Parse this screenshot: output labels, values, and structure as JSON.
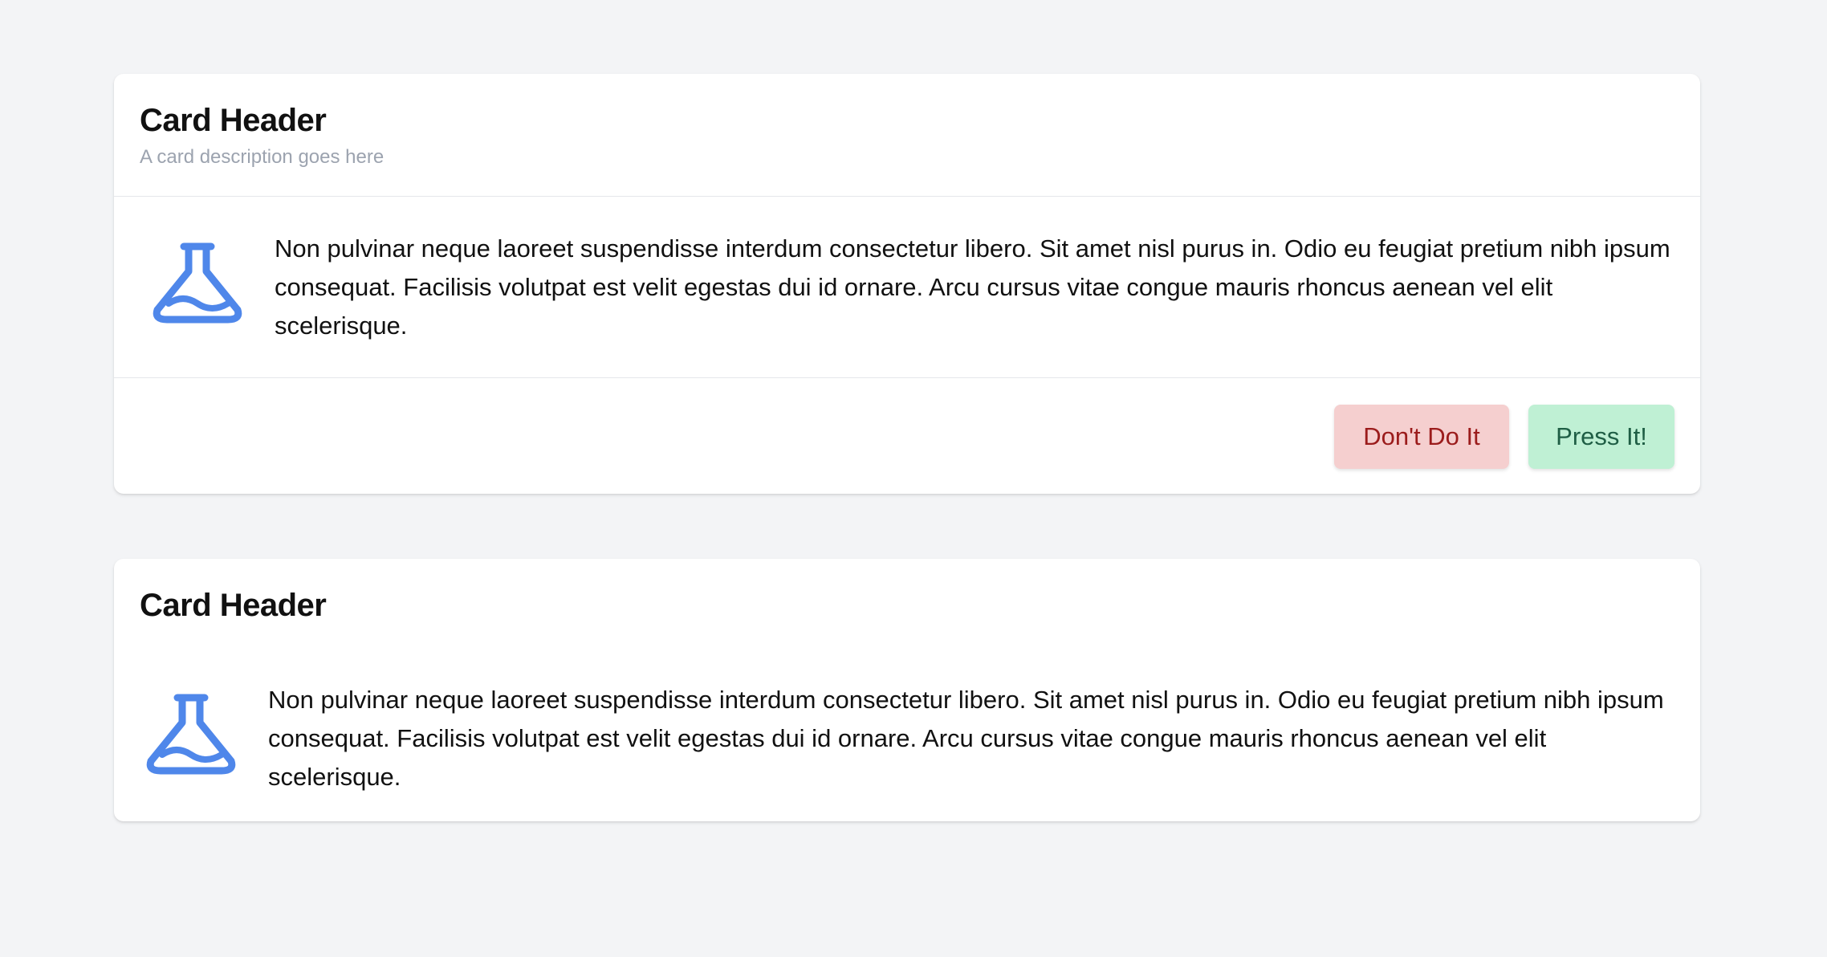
{
  "cards": [
    {
      "title": "Card Header",
      "description": "A card description goes here",
      "icon": "beaker-icon",
      "body": "Non pulvinar neque laoreet suspendisse interdum consectetur libero. Sit amet nisl purus in. Odio eu feugiat pretium nibh ipsum consequat. Facilisis volutpat est velit egestas dui id ornare. Arcu cursus vitae congue mauris rhoncus aenean vel elit scelerisque.",
      "footer": {
        "secondary_label": "Don't Do It",
        "primary_label": "Press It!"
      }
    },
    {
      "title": "Card Header",
      "icon": "beaker-icon",
      "body": "Non pulvinar neque laoreet suspendisse interdum consectetur libero. Sit amet nisl purus in. Odio eu feugiat pretium nibh ipsum consequat. Facilisis volutpat est velit egestas dui id ornare. Arcu cursus vitae congue mauris rhoncus aenean vel elit scelerisque."
    }
  ],
  "colors": {
    "background": "#f3f4f6",
    "card": "#ffffff",
    "icon": "#4f87ea",
    "description": "#9ca3af",
    "danger_bg": "#f5cfcf",
    "danger_text": "#9b1c1c",
    "success_bg": "#bff0d4",
    "success_text": "#1f5e45"
  }
}
